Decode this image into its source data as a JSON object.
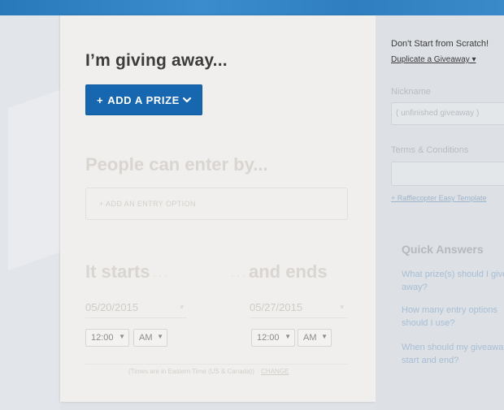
{
  "main": {
    "title": "I’m giving away...",
    "add_prize_label": "ADD A PRIZE",
    "add_prize_plus": "+",
    "enter_heading": "People can enter by...",
    "entry_option": "+ ADD AN ENTRY OPTION",
    "starts_label": "It starts",
    "ends_label": "and ends",
    "start_date": "05/20/2015",
    "end_date": "05/27/2015",
    "start_time": "12:00",
    "start_ampm": "AM",
    "end_time": "12:00",
    "end_ampm": "AM",
    "timezone_note": "(Times are in Eastern Time (US & Canada))",
    "change_link": "CHANGE"
  },
  "sidebar": {
    "scratch_title": "Don't Start from Scratch!",
    "duplicate_link": "Duplicate a Giveaway",
    "nickname_label": "Nickname",
    "nickname_value": "( unfinished giveaway )",
    "terms_label": "Terms & Conditions",
    "terms_template_link": "Rafflecopter Easy Template",
    "quick_answers_title": "Quick Answers",
    "questions": [
      "What prize(s) should I give away?",
      "How many entry options should I use?",
      "When should my giveaway start and end?"
    ]
  },
  "colors": {
    "brand_blue": "#1767b0",
    "topbar_blue": "#2f7fc0"
  }
}
